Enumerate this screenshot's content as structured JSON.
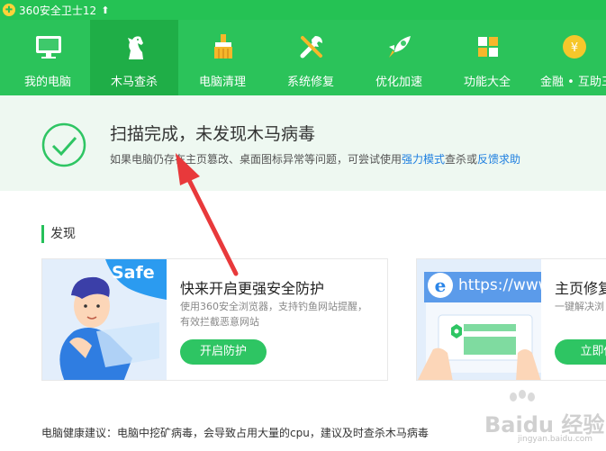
{
  "window": {
    "title": "360安全卫士12"
  },
  "nav": {
    "items": [
      {
        "label": "我的电脑",
        "icon": "monitor-icon"
      },
      {
        "label": "木马查杀",
        "icon": "horse-icon",
        "active": true
      },
      {
        "label": "电脑清理",
        "icon": "broom-icon"
      },
      {
        "label": "系统修复",
        "icon": "wrench-icon"
      },
      {
        "label": "优化加速",
        "icon": "rocket-icon"
      },
      {
        "label": "功能大全",
        "icon": "grid-icon"
      },
      {
        "label": "金融 • 互助三",
        "icon": "yuan-coin-icon"
      }
    ]
  },
  "result": {
    "title": "扫描完成，未发现木马病毒",
    "desc_prefix": "如果电脑仍存在主页篡改、桌面图标异常等问题，可尝试使用",
    "link_strong": "强力模式",
    "desc_middle": "查杀或",
    "link_feedback": "反馈求助"
  },
  "section": {
    "label": "发现"
  },
  "cards": [
    {
      "badge": "Safe",
      "title": "快来开启更强安全防护",
      "desc": "使用360安全浏览器，支持钓鱼网站提醒，有效拦截恶意网站",
      "button": "开启防护"
    },
    {
      "url_text": "https://www",
      "title": "主页修复",
      "desc": "一键解决浏",
      "button": "立即修"
    }
  ],
  "advice": "电脑健康建议：电脑中挖矿病毒，会导致占用大量的cpu，建议及时查杀木马病毒",
  "watermark": {
    "brand": "Baidu 经验",
    "sub": "jingyan.baidu.com"
  },
  "colors": {
    "brand_green": "#2bc35a",
    "active_green": "#1fae47",
    "link_blue": "#1f7fe0",
    "arrow_red": "#e8393b"
  }
}
